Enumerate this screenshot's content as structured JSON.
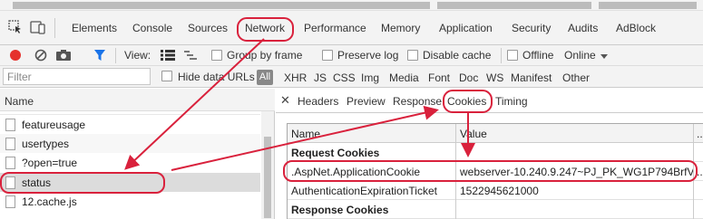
{
  "tabs": [
    {
      "label": "Elements",
      "id": "elements"
    },
    {
      "label": "Console",
      "id": "console"
    },
    {
      "label": "Sources",
      "id": "sources"
    },
    {
      "label": "Network",
      "id": "network",
      "active": true
    },
    {
      "label": "Performance",
      "id": "performance"
    },
    {
      "label": "Memory",
      "id": "memory"
    },
    {
      "label": "Application",
      "id": "application"
    },
    {
      "label": "Security",
      "id": "security"
    },
    {
      "label": "Audits",
      "id": "audits"
    },
    {
      "label": "AdBlock",
      "id": "adblock"
    }
  ],
  "toolbar": {
    "view_label": "View:",
    "group_by_frame": "Group by frame",
    "preserve_log": "Preserve log",
    "disable_cache": "Disable cache",
    "offline": "Offline",
    "online": "Online"
  },
  "filter": {
    "placeholder": "Filter",
    "hide_data_urls": "Hide data URLs",
    "all": "All",
    "types": [
      "XHR",
      "JS",
      "CSS",
      "Img",
      "Media",
      "Font",
      "Doc",
      "WS",
      "Manifest",
      "Other"
    ]
  },
  "requests": {
    "header": "Name",
    "items": [
      "featureusage",
      "usertypes",
      "?open=true",
      "status",
      "12.cache.js"
    ]
  },
  "detail": {
    "tabs": [
      "Headers",
      "Preview",
      "Response",
      "Cookies",
      "Timing"
    ],
    "active_tab": "Cookies",
    "columns": {
      "name": "Name",
      "value": "Value",
      "more": "..."
    },
    "request_cookies_heading": "Request Cookies",
    "cookies": [
      {
        "name": ".AspNet.ApplicationCookie",
        "value": "webserver-10.240.9.247~PJ_PK_WG1P794BrfV...",
        "more": ".."
      },
      {
        "name": "AuthenticationExpirationTicket",
        "value": "1522945621000",
        "more": ""
      }
    ],
    "response_cookies_heading": "Response Cookies"
  },
  "colors": {
    "annotation_red": "#d9213c",
    "record_red": "#e5322d",
    "filter_blue": "#1a73e8",
    "selected_row": "#dcdcdc"
  }
}
